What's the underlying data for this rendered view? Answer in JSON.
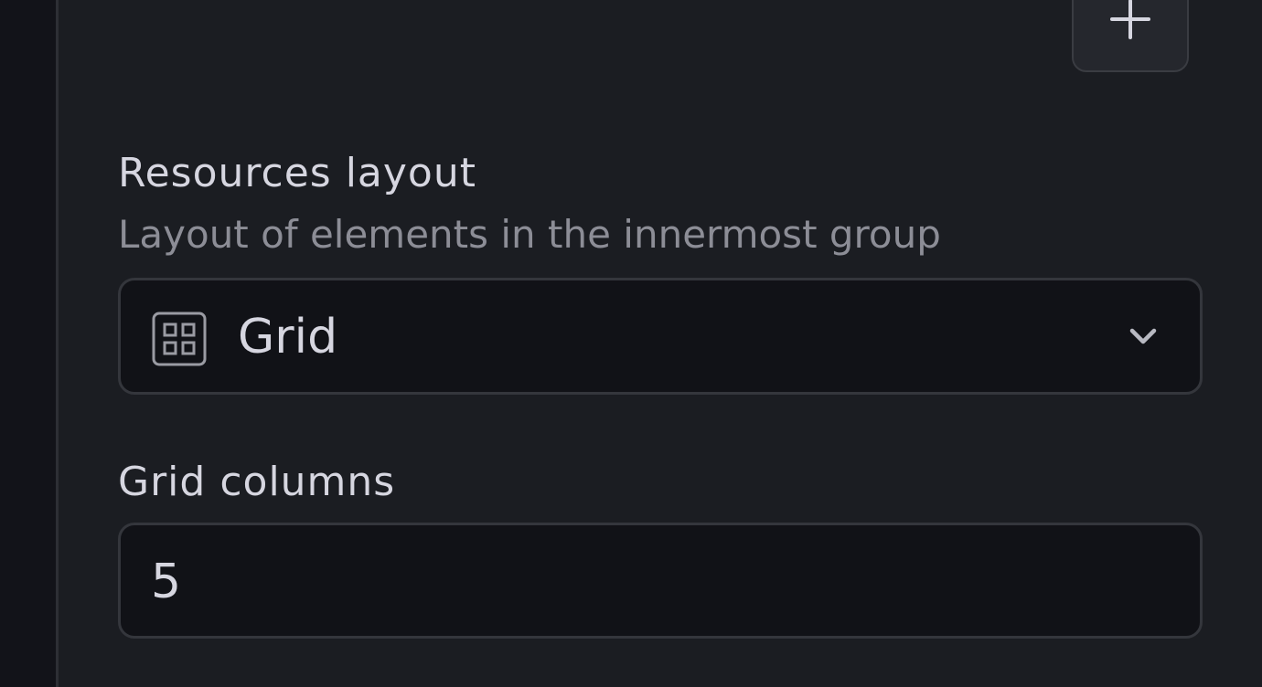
{
  "header": {
    "add_icon": "plus-icon"
  },
  "resources_layout": {
    "label": "Resources layout",
    "description": "Layout of elements in the innermost group",
    "selected": "Grid",
    "selected_icon": "grid-icon",
    "dropdown_icon": "chevron-down-icon"
  },
  "grid_columns": {
    "label": "Grid columns",
    "value": "5"
  },
  "colors": {
    "panel_bg": "#1b1d22",
    "field_bg": "#111217",
    "border": "#34363c",
    "text": "#d6d6e0",
    "muted_text": "#8c8d96"
  }
}
